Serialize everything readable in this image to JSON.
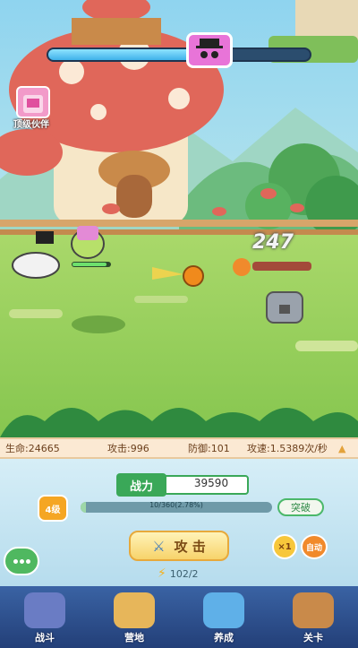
{
  "boss": {
    "hp_fraction": 0.55
  },
  "bag": {
    "label": "顶级伙伴"
  },
  "combat": {
    "damage_popup": "247"
  },
  "stats": {
    "hp": "生命:24665",
    "attack": "攻击:996",
    "defense": "防御:101",
    "speed": "攻速:1.5389次/秒"
  },
  "power": {
    "label": "战力",
    "value": "39590"
  },
  "level": {
    "badge": "4级",
    "exp_text": "10/360(2.78%)",
    "exp_fraction": 0.0278,
    "breakthrough_label": "突破"
  },
  "attack": {
    "label": "攻 击"
  },
  "controls": {
    "speed_label": "×1",
    "auto_label": "自动"
  },
  "energy": {
    "value": "102/2"
  },
  "nav": [
    {
      "label": "战斗",
      "icon": "battle-icon"
    },
    {
      "label": "营地",
      "icon": "camp-icon"
    },
    {
      "label": "养成",
      "icon": "cultivate-icon"
    },
    {
      "label": "关卡",
      "icon": "stage-icon"
    }
  ],
  "colors": {
    "stats_text": "#6b3f1c",
    "power_green": "#3aa858",
    "nav_bg": "#2d4e8e"
  }
}
